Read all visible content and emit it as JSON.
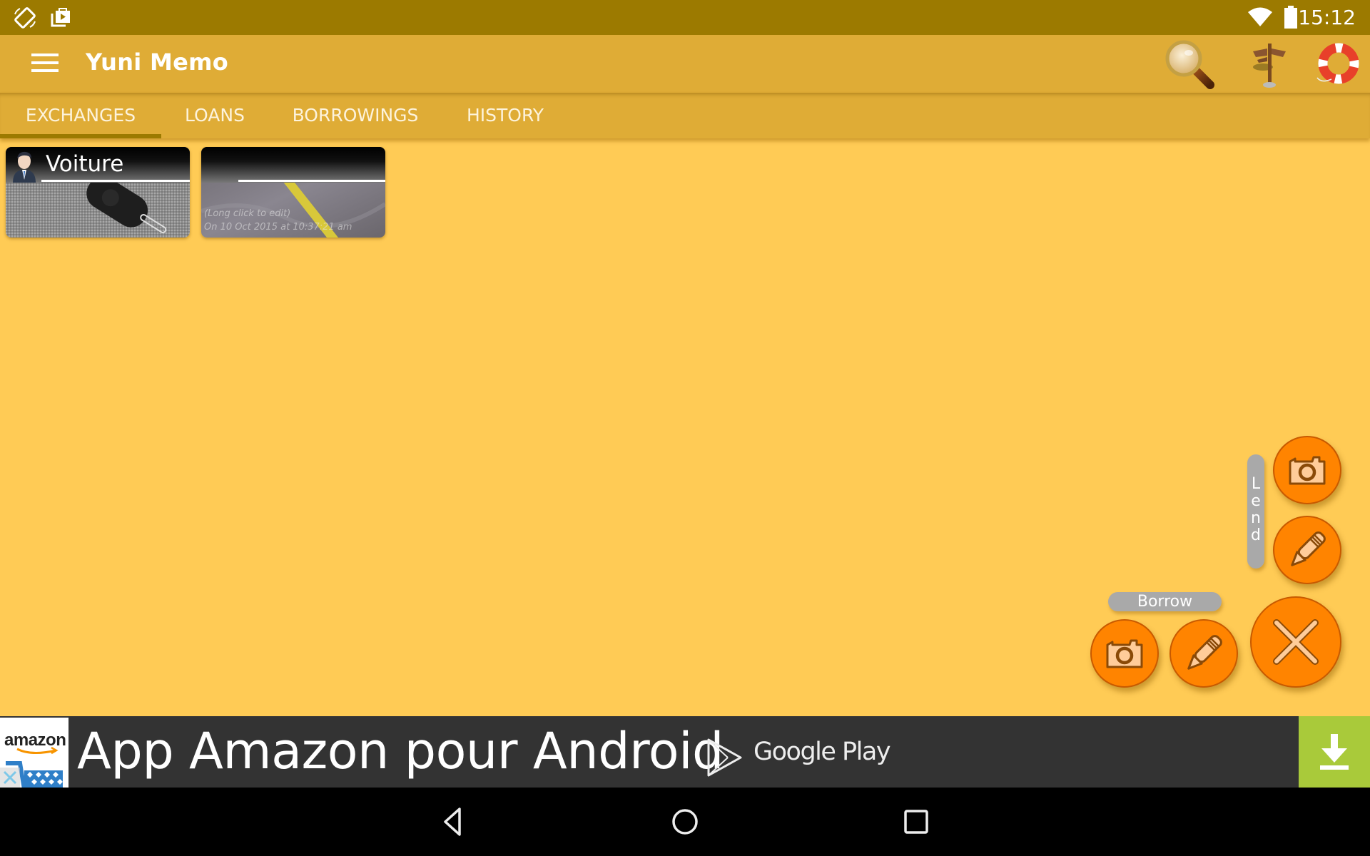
{
  "status_bar": {
    "icons": [
      "screen-rotation-icon",
      "play-store-notification-icon",
      "wifi-icon",
      "battery-icon"
    ],
    "time": "15:12"
  },
  "app_bar": {
    "title": "Yuni Memo",
    "menu_icon": "hamburger-menu-icon",
    "actions": [
      {
        "name": "search",
        "icon": "magnifying-glass-icon"
      },
      {
        "name": "navigate",
        "icon": "signpost-icon"
      },
      {
        "name": "help",
        "icon": "lifebuoy-icon"
      }
    ]
  },
  "tabs": [
    {
      "label": "EXCHANGES",
      "active": true
    },
    {
      "label": "LOANS",
      "active": false
    },
    {
      "label": "BORROWINGS",
      "active": false
    },
    {
      "label": "HISTORY",
      "active": false
    }
  ],
  "cards": [
    {
      "title": "Voiture",
      "has_contact_avatar": true,
      "photo": "car key on carpet",
      "hint": "",
      "date": ""
    },
    {
      "title": "",
      "has_contact_avatar": false,
      "photo": "tape measure on fabric",
      "hint": "(Long click to edit)",
      "date": "On 10 Oct 2015 at 10:37:21 am"
    }
  ],
  "fab_menu": {
    "lend_label": "Lend",
    "borrow_label": "Borrow",
    "buttons": [
      {
        "name": "lend-photo",
        "icon": "camera-icon"
      },
      {
        "name": "lend-text",
        "icon": "pencil-icon"
      },
      {
        "name": "borrow-photo",
        "icon": "camera-icon"
      },
      {
        "name": "borrow-text",
        "icon": "pencil-icon"
      },
      {
        "name": "close",
        "icon": "close-x-icon"
      }
    ],
    "colors": {
      "fab": "#FF8400",
      "icon_fill": "#FFCC99",
      "label_bg": "#A9A9A9"
    }
  },
  "ad": {
    "brand": "amazon",
    "text": "App Amazon pour Android",
    "store": "Google Play",
    "download_icon": "download-icon",
    "close_icon": "close-icon",
    "accent": "#A9CA3A"
  },
  "nav_bar": {
    "buttons": [
      "back-icon",
      "home-icon",
      "recents-icon"
    ]
  },
  "theme": {
    "status_bar": "#9C7A00",
    "app_bar": "#DFAC36",
    "background": "#FFCB55"
  }
}
